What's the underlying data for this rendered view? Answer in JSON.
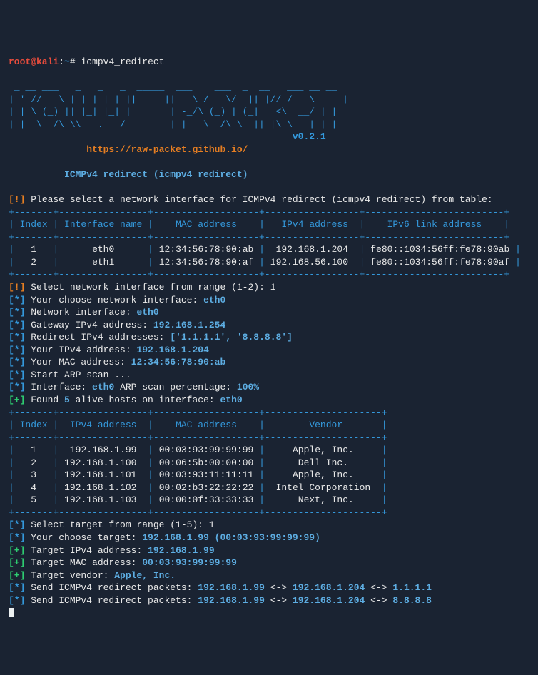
{
  "prompt": {
    "user": "root@kali",
    "sep": ":",
    "path": "~",
    "sym": "#",
    "command": "icmpv4_redirect"
  },
  "ascii": {
    "l1": " _ __ ___   _   _   _  _____  ___    ___  _  __   ___ __ __",
    "l2": "| '_//   \\ | | | | | ||_____|| _ \\ /   \\/ _|| |// / _ \\_   _|",
    "l3": "| | \\ (_) || |_| |_| |       | -_/\\ (_) | (_|   <\\  __/ | |",
    "l4": "|_|  \\__/\\_\\\\___.___/        |_|   \\__/\\_\\__||_|\\_\\___| |_|",
    "version": "v0.2.1"
  },
  "url": "https://raw-packet.github.io/",
  "header1": "ICMPv4 redirect (icmpv4_redirect)",
  "warn1": "Please select a network interface for ICMPv4 redirect (icmpv4_redirect) from table:",
  "table1": {
    "border_top": "+-------+----------------+-------------------+-----------------+-------------------------+",
    "border_mid": "+-------+----------------+-------------------+-----------------+-------------------------+",
    "border_bot": "+-------+----------------+-------------------+-----------------+-------------------------+",
    "hdr_index": "Index",
    "hdr_iface": "Interface name",
    "hdr_mac": "MAC address",
    "hdr_ipv4": "IPv4 address",
    "hdr_ipv6": "IPv6 link address",
    "r1": {
      "idx": "1",
      "iface": "eth0",
      "mac": "12:34:56:78:90:ab",
      "ipv4": "192.168.1.204",
      "ipv6": "fe80::1034:56ff:fe78:90ab"
    },
    "r2": {
      "idx": "2",
      "iface": "eth1",
      "mac": "12:34:56:78:90:af",
      "ipv4": "192.168.56.100",
      "ipv6": "fe80::1034:56ff:fe78:90af"
    }
  },
  "lines": {
    "sel_iface_prompt": "Select network interface from range (1-2): ",
    "sel_iface_ans": "1",
    "choose_iface_lbl": "Your choose network interface: ",
    "choose_iface_val": "eth0",
    "net_iface_lbl": "Network interface: ",
    "net_iface_val": "eth0",
    "gw_lbl": "Gateway IPv4 address: ",
    "gw_val": "192.168.1.254",
    "redir_lbl": "Redirect IPv4 addresses: ",
    "redir_val": "['1.1.1.1', '8.8.8.8']",
    "your_ip_lbl": "Your IPv4 address: ",
    "your_ip_val": "192.168.1.204",
    "your_mac_lbl": "Your MAC address: ",
    "your_mac_val": "12:34:56:78:90:ab",
    "arp_start": "Start ARP scan ...",
    "arp_iface_lbl": "Interface: ",
    "arp_iface_val": "eth0",
    "arp_scan_lbl": " ARP scan percentage: ",
    "arp_scan_val": "100%",
    "found_lbl1": "Found ",
    "found_count": "5",
    "found_lbl2": " alive hosts on interface: ",
    "found_iface": "eth0"
  },
  "table2": {
    "border_top": "+-------+----------------+-------------------+---------------------+",
    "border_mid": "+-------+----------------+-------------------+---------------------+",
    "border_bot": "+-------+----------------+-------------------+---------------------+",
    "hdr_index": "Index",
    "hdr_ipv4": "IPv4 address",
    "hdr_mac": "MAC address",
    "hdr_vendor": "Vendor",
    "r1": {
      "idx": "1",
      "ip": "192.168.1.99",
      "mac": "00:03:93:99:99:99",
      "vendor": "Apple, Inc."
    },
    "r2": {
      "idx": "2",
      "ip": "192.168.1.100",
      "mac": "00:06:5b:00:00:00",
      "vendor": "Dell Inc."
    },
    "r3": {
      "idx": "3",
      "ip": "192.168.1.101",
      "mac": "00:03:93:11:11:11",
      "vendor": "Apple, Inc."
    },
    "r4": {
      "idx": "4",
      "ip": "192.168.1.102",
      "mac": "00:02:b3:22:22:22",
      "vendor": "Intel Corporation"
    },
    "r5": {
      "idx": "5",
      "ip": "192.168.1.103",
      "mac": "00:00:0f:33:33:33",
      "vendor": "Next, Inc."
    }
  },
  "target": {
    "sel_prompt": "Select target from range (1-5): ",
    "sel_ans": "1",
    "choose_lbl": "Your choose target: ",
    "choose_val": "192.168.1.99 (00:03:93:99:99:99)",
    "ip_lbl": "Target IPv4 address: ",
    "ip_val": "192.168.1.99",
    "mac_lbl": "Target MAC address: ",
    "mac_val": "00:03:93:99:99:99",
    "vendor_lbl": "Target vendor: ",
    "vendor_val": "Apple, Inc."
  },
  "send": {
    "lbl": "Send ICMPv4 redirect packets: ",
    "p1_a": "192.168.1.99",
    "arrow": " <-> ",
    "p1_b": "192.168.1.204",
    "p1_c": "1.1.1.1",
    "p2_c": "8.8.8.8"
  },
  "markers": {
    "warn": "[!]",
    "info": "[*]",
    "plus": "[+]"
  }
}
